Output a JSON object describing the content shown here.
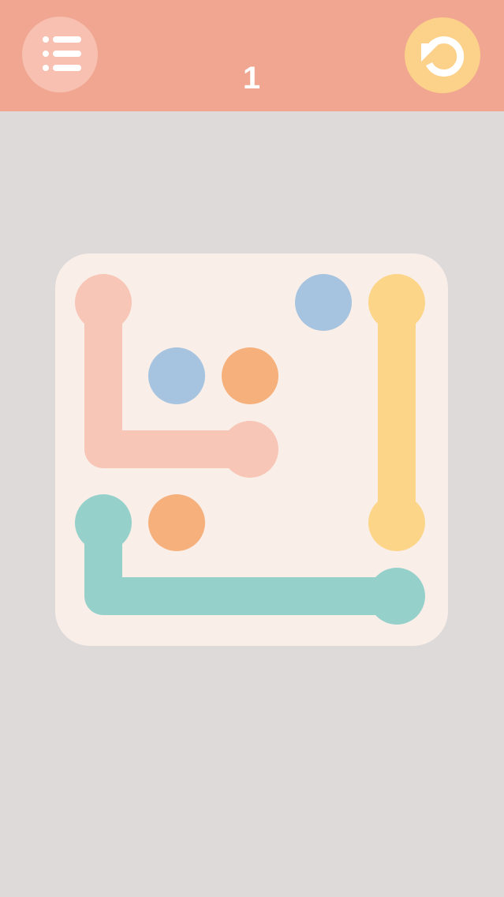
{
  "header": {
    "menu_icon": "list-icon",
    "undo_icon": "undo-icon",
    "level_label": "1",
    "background_color": "#f0a690"
  },
  "board": {
    "rows": 5,
    "cols": 5,
    "background_color": "#f9eee8",
    "colors": {
      "pink": "#f8c6b6",
      "blue": "#a6c4df",
      "orange": "#f6b07c",
      "yellow": "#fcd588",
      "teal": "#95d0cb"
    },
    "dots": [
      {
        "color": "pink",
        "row": 0,
        "col": 0
      },
      {
        "color": "pink",
        "row": 2,
        "col": 2
      },
      {
        "color": "blue",
        "row": 0,
        "col": 3
      },
      {
        "color": "blue",
        "row": 1,
        "col": 1
      },
      {
        "color": "orange",
        "row": 1,
        "col": 2
      },
      {
        "color": "orange",
        "row": 3,
        "col": 1
      },
      {
        "color": "yellow",
        "row": 0,
        "col": 4
      },
      {
        "color": "yellow",
        "row": 3,
        "col": 4
      },
      {
        "color": "teal",
        "row": 3,
        "col": 0
      },
      {
        "color": "teal",
        "row": 4,
        "col": 4
      }
    ],
    "paths": [
      {
        "color": "pink",
        "cells": [
          [
            0,
            0
          ],
          [
            1,
            0
          ],
          [
            2,
            0
          ],
          [
            2,
            1
          ],
          [
            2,
            2
          ]
        ]
      },
      {
        "color": "yellow",
        "cells": [
          [
            0,
            4
          ],
          [
            1,
            4
          ],
          [
            2,
            4
          ],
          [
            3,
            4
          ]
        ]
      },
      {
        "color": "teal",
        "cells": [
          [
            3,
            0
          ],
          [
            4,
            0
          ],
          [
            4,
            1
          ],
          [
            4,
            2
          ],
          [
            4,
            3
          ],
          [
            4,
            4
          ]
        ]
      }
    ]
  }
}
